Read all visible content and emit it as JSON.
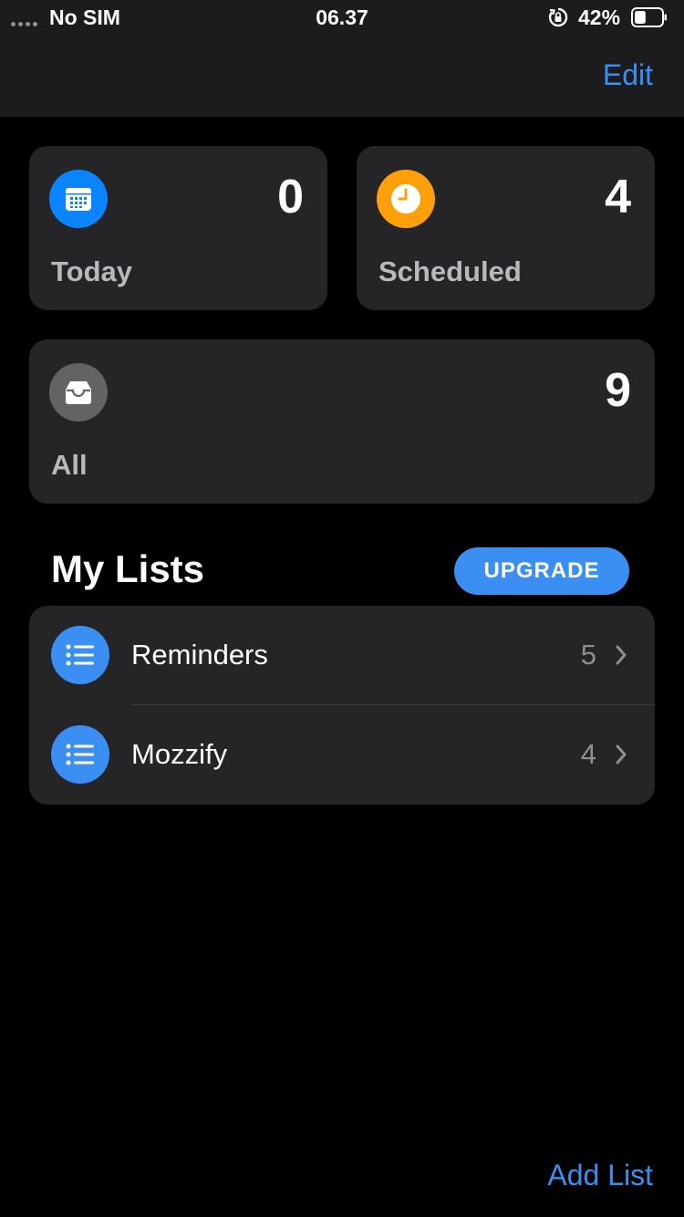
{
  "status_bar": {
    "carrier": "No SIM",
    "time": "06.37",
    "battery_percent": "42%",
    "battery_level": 0.42,
    "icons": [
      "signal-dots-icon",
      "orientation-lock-icon",
      "battery-icon"
    ]
  },
  "navbar": {
    "edit_label": "Edit"
  },
  "smart_lists": [
    {
      "label": "Today",
      "count": "0",
      "icon": "calendar-icon",
      "color": "#0a84ff"
    },
    {
      "label": "Scheduled",
      "count": "4",
      "icon": "clock-icon",
      "color": "#ff9f0a"
    },
    {
      "label": "All",
      "count": "9",
      "icon": "tray-icon",
      "color": "#636366"
    }
  ],
  "my_lists": {
    "title": "My Lists",
    "upgrade_label": "UPGRADE",
    "items": [
      {
        "name": "Reminders",
        "count": "5",
        "icon": "list-bullet-icon",
        "color": "#3c8ff2"
      },
      {
        "name": "Mozzify",
        "count": "4",
        "icon": "list-bullet-icon",
        "color": "#3c8ff2"
      }
    ]
  },
  "footer": {
    "add_list_label": "Add List"
  },
  "colors": {
    "accent": "#3a8ff5",
    "background": "#000000",
    "card": "#252527"
  }
}
